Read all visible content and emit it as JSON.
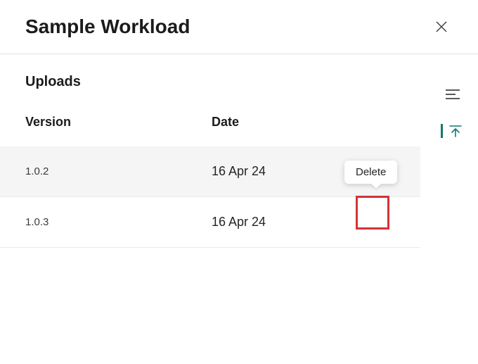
{
  "header": {
    "title": "Sample Workload"
  },
  "section": {
    "title": "Uploads"
  },
  "columns": {
    "version": "Version",
    "date": "Date"
  },
  "rows": [
    {
      "version": "1.0.2",
      "date": "16 Apr 24",
      "selected": true,
      "showDelete": true
    },
    {
      "version": "1.0.3",
      "date": "16 Apr 24",
      "selected": false,
      "showDelete": false
    }
  ],
  "tooltip": {
    "delete": "Delete"
  },
  "icons": {
    "close": "close-icon",
    "hamburger": "hamburger-icon",
    "upload": "upload-to-top-icon",
    "trash": "trash-icon"
  },
  "colors": {
    "accent": "#0f7b6c",
    "highlight": "#d13438"
  }
}
